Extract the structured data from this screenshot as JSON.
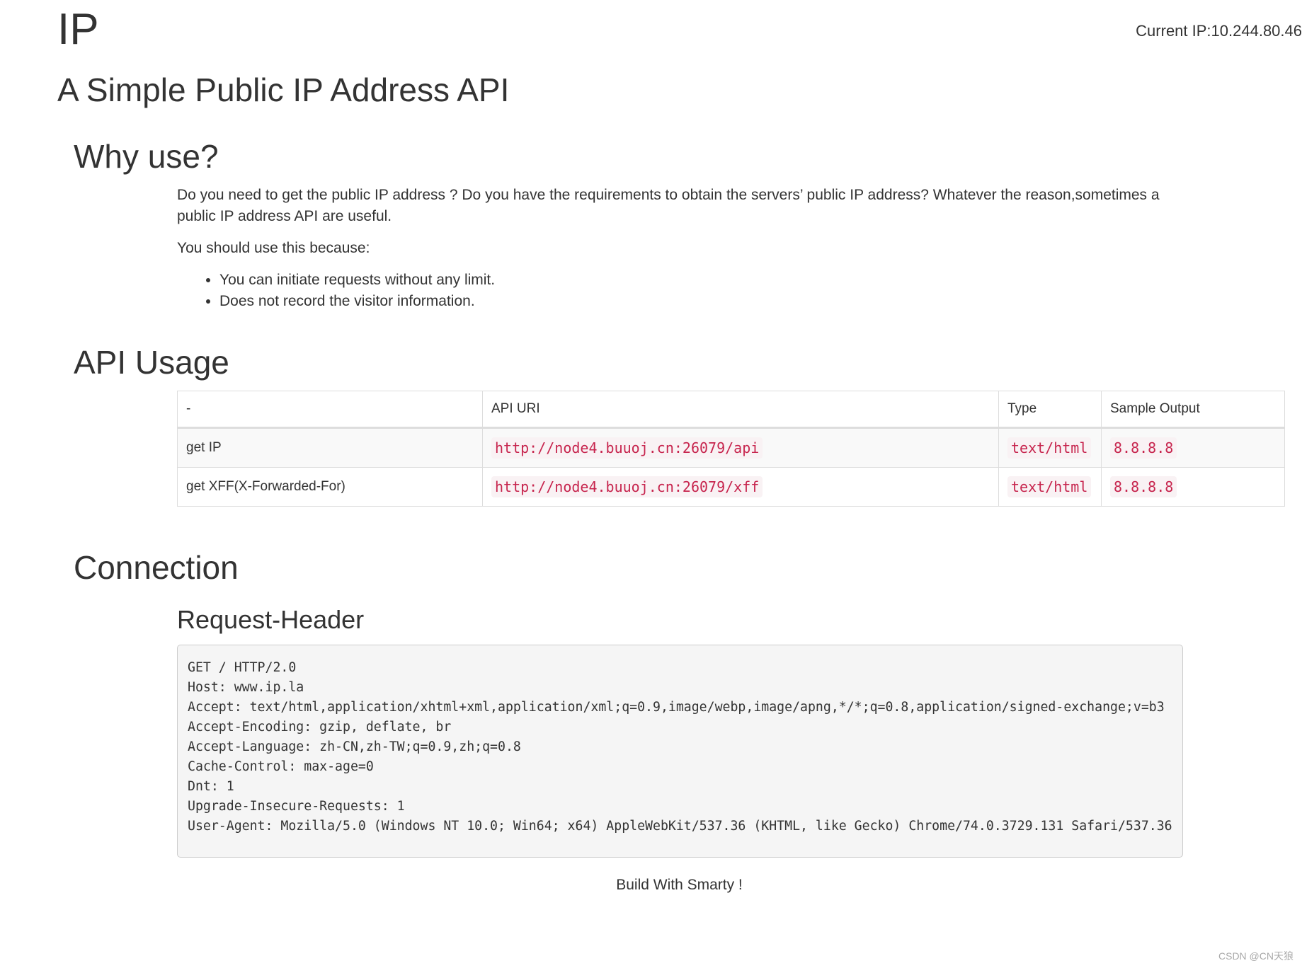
{
  "header": {
    "title": "IP",
    "current_ip": "Current IP:10.244.80.46"
  },
  "subtitle": "A Simple Public IP Address API",
  "why_use": {
    "heading": "Why use?",
    "paragraph": "Do you need to get the public IP address ? Do you have the requirements to obtain the servers’ public IP address? Whatever the reason,sometimes a public IP address API are useful.",
    "reason_intro": "You should use this because:",
    "reasons": [
      "You can initiate requests without any limit.",
      "Does not record the visitor information."
    ]
  },
  "api_usage": {
    "heading": "API Usage",
    "columns": [
      "-",
      "API URI",
      "Type",
      "Sample Output"
    ],
    "rows": [
      {
        "name": "get IP",
        "uri": "http://node4.buuoj.cn:26079/api",
        "type": "text/html",
        "sample": "8.8.8.8"
      },
      {
        "name": "get XFF(X-Forwarded-For)",
        "uri": "http://node4.buuoj.cn:26079/xff",
        "type": "text/html",
        "sample": "8.8.8.8"
      }
    ]
  },
  "connection": {
    "heading": "Connection",
    "subheading": "Request-Header",
    "request_lines": [
      "GET / HTTP/2.0",
      "Host: www.ip.la",
      "Accept: text/html,application/xhtml+xml,application/xml;q=0.9,image/webp,image/apng,*/*;q=0.8,application/signed-exchange;v=b3",
      "Accept-Encoding: gzip, deflate, br",
      "Accept-Language: zh-CN,zh-TW;q=0.9,zh;q=0.8",
      "Cache-Control: max-age=0",
      "Dnt: 1",
      "Upgrade-Insecure-Requests: 1",
      "User-Agent: Mozilla/5.0 (Windows NT 10.0; Win64; x64) AppleWebKit/537.36 (KHTML, like Gecko) Chrome/74.0.3729.131 Safari/537.36"
    ]
  },
  "footer": "Build With Smarty !",
  "watermark": "CSDN @CN天狼",
  "colors": {
    "code_text": "#c7254e",
    "code_background": "#f9f2f4",
    "pre_background": "#f5f5f5",
    "table_border": "#dddddd",
    "stripe": "#f9f9f9"
  }
}
